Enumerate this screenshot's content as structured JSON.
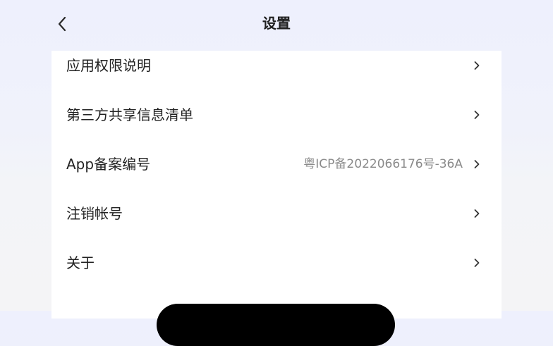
{
  "header": {
    "title": "设置",
    "back_icon": "chevron-left-icon"
  },
  "menu": {
    "items": [
      {
        "label": "应用权限说明",
        "value": "",
        "icon": "chevron-right-icon"
      },
      {
        "label": "第三方共享信息清单",
        "value": "",
        "icon": "chevron-right-icon"
      },
      {
        "label": "App备案编号",
        "value": "粤ICP备2022066176号-36A",
        "icon": "chevron-right-icon"
      },
      {
        "label": "注销帐号",
        "value": "",
        "icon": "chevron-right-icon"
      },
      {
        "label": "关于",
        "value": "",
        "icon": "chevron-right-icon"
      }
    ]
  },
  "colors": {
    "background": "#eef0fd",
    "card": "#ffffff",
    "label_text": "#222222",
    "value_text": "#8a8a8a",
    "chevron": "#333333",
    "bottom_button": "#000000"
  }
}
